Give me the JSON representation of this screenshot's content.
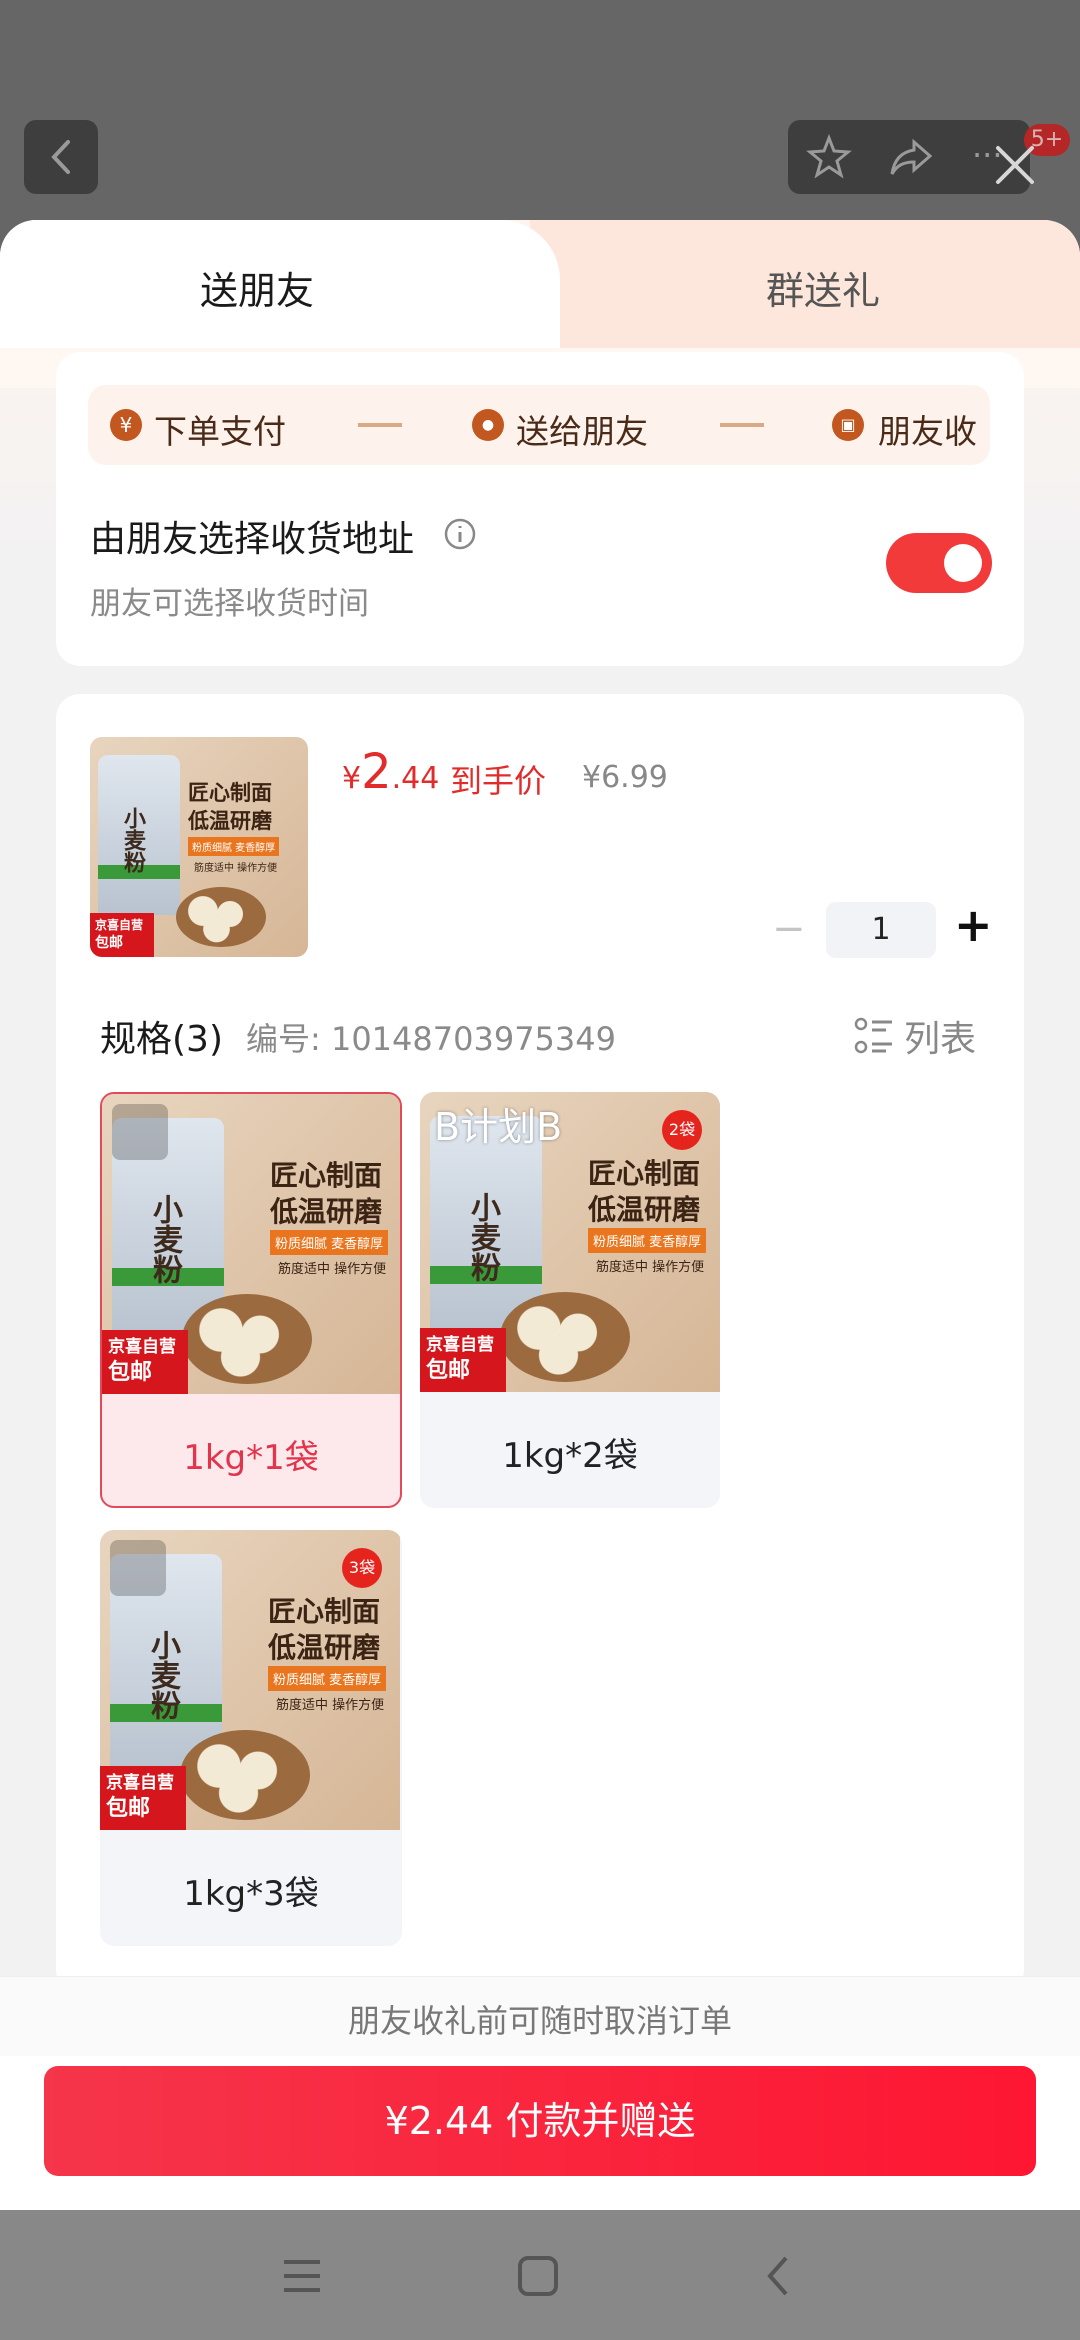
{
  "header": {
    "back_icon": "chevron-left-icon",
    "star_icon": "star-icon",
    "share_icon": "share-icon",
    "more_icon": "more-icon",
    "notification_badge": "5+",
    "close_icon": "close-icon"
  },
  "tabs": [
    {
      "label": "送朋友",
      "active": true
    },
    {
      "label": "群送礼",
      "active": false
    }
  ],
  "steps": [
    {
      "icon": "¥",
      "label": "下单支付"
    },
    {
      "icon": "●",
      "label": "送给朋友"
    },
    {
      "icon": "▣",
      "label": "朋友收"
    }
  ],
  "address": {
    "title": "由朋友选择收货地址",
    "subtitle": "朋友可选择收货时间",
    "toggle_on": true
  },
  "product": {
    "price_symbol": "¥",
    "price_int": "2",
    "price_dec": ".44",
    "price_label": "到手价",
    "original_price": "¥6.99",
    "quantity": "1",
    "minus": "−",
    "plus": "+",
    "image_text": {
      "headline1": "匠心制面",
      "headline2": "低温研磨",
      "tag1": "粉质细腻 麦香醇厚",
      "tag2": "筋度适中 操作方便",
      "bag_label": "小麦粉",
      "shop_tag": "京喜自营",
      "shipping_tag": "包邮"
    }
  },
  "specs": {
    "title": "规格(3)",
    "code": "编号: 10148703975349",
    "list_label": "列表",
    "items": [
      {
        "label": "1kg*1袋",
        "selected": true,
        "overlay": "",
        "badge": ""
      },
      {
        "label": "1kg*2袋",
        "selected": false,
        "overlay": "B计划B",
        "badge": "2袋"
      },
      {
        "label": "1kg*3袋",
        "selected": false,
        "overlay": "",
        "badge": "3袋"
      }
    ]
  },
  "footer": {
    "notice": "朋友收礼前可随时取消订单",
    "pay_button": "¥2.44 付款并赠送"
  },
  "colors": {
    "accent": "#f23a3a",
    "price": "#e22b2b",
    "step_bg": "#fdf3ec",
    "selected_bg": "#fde8ec"
  }
}
